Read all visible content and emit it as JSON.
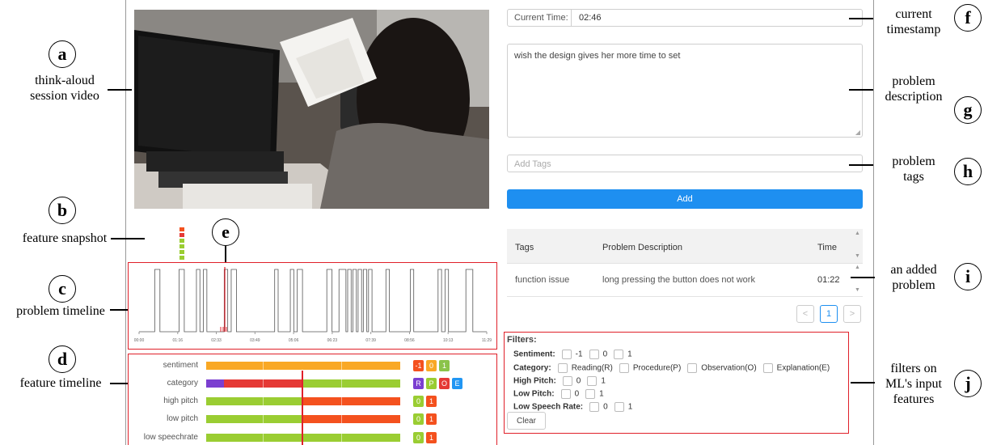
{
  "annotations": {
    "a": {
      "letter": "a",
      "text_lines": [
        "think-aloud",
        "session video"
      ]
    },
    "b": {
      "letter": "b",
      "text_lines": [
        "feature snapshot"
      ]
    },
    "c": {
      "letter": "c",
      "text_lines": [
        "problem timeline"
      ]
    },
    "d": {
      "letter": "d",
      "text_lines": [
        "feature timeline"
      ]
    },
    "e": {
      "letter": "e"
    },
    "f": {
      "letter": "f",
      "text_lines": [
        "current",
        "timestamp"
      ]
    },
    "g": {
      "letter": "g",
      "text_lines": [
        "problem",
        "description"
      ]
    },
    "h": {
      "letter": "h",
      "text_lines": [
        "problem",
        "tags"
      ]
    },
    "i": {
      "letter": "i",
      "text_lines": [
        "an added",
        "problem"
      ]
    },
    "j": {
      "letter": "j",
      "text_lines": [
        "filters on",
        "ML's input",
        "features"
      ]
    }
  },
  "current_time": {
    "label": "Current Time:",
    "value": "02:46"
  },
  "description": {
    "value": "wish the design gives her more time to set"
  },
  "tags_input": {
    "placeholder": "Add Tags"
  },
  "add_button": {
    "label": "Add"
  },
  "table": {
    "headers": {
      "tags": "Tags",
      "description": "Problem Description",
      "time": "Time"
    },
    "rows": [
      {
        "tags": "function issue",
        "description": "long pressing the button does not work",
        "time": "01:22"
      }
    ]
  },
  "pagination": {
    "prev": "<",
    "page": "1",
    "next": ">"
  },
  "filters": {
    "title": "Filters:",
    "sentiment": {
      "label": "Sentiment:",
      "options": [
        "-1",
        "0",
        "1"
      ]
    },
    "category": {
      "label": "Category:",
      "options": [
        "Reading(R)",
        "Procedure(P)",
        "Observation(O)",
        "Explanation(E)"
      ]
    },
    "high_pitch": {
      "label": "High Pitch:",
      "options": [
        "0",
        "1"
      ]
    },
    "low_pitch": {
      "label": "Low Pitch:",
      "options": [
        "0",
        "1"
      ]
    },
    "low_speech_rate": {
      "label": "Low Speech Rate:",
      "options": [
        "0",
        "1"
      ]
    },
    "clear_label": "Clear"
  },
  "feature_timeline": {
    "rows": [
      {
        "label": "sentiment",
        "badges": [
          {
            "text": "-1",
            "color": "#f4511e"
          },
          {
            "text": "0",
            "color": "#f9a825"
          },
          {
            "text": "1",
            "color": "#8bc34a"
          }
        ]
      },
      {
        "label": "category",
        "badges": [
          {
            "text": "R",
            "color": "#7b3fd0"
          },
          {
            "text": "P",
            "color": "#9acd32"
          },
          {
            "text": "O",
            "color": "#e53935"
          },
          {
            "text": "E",
            "color": "#2196f3"
          }
        ]
      },
      {
        "label": "high pitch",
        "badges": [
          {
            "text": "0",
            "color": "#9acd32"
          },
          {
            "text": "1",
            "color": "#f4511e"
          }
        ]
      },
      {
        "label": "low pitch",
        "badges": [
          {
            "text": "0",
            "color": "#9acd32"
          },
          {
            "text": "1",
            "color": "#f4511e"
          }
        ]
      },
      {
        "label": "low speechrate",
        "badges": [
          {
            "text": "0",
            "color": "#9acd32"
          },
          {
            "text": "1",
            "color": "#f4511e"
          }
        ]
      }
    ]
  },
  "problem_timeline": {
    "tick_labels": [
      "00:00",
      "01:16",
      "02:33",
      "03:49",
      "05:06",
      "06:23",
      "07:39",
      "08:56",
      "10:13",
      "11:29"
    ]
  },
  "colors": {
    "accent": "#1e8ff0",
    "highlight": "#e0202a",
    "green": "#9acd32",
    "orange": "#f4511e",
    "amber": "#f9a825",
    "purple": "#7b3fd0"
  }
}
